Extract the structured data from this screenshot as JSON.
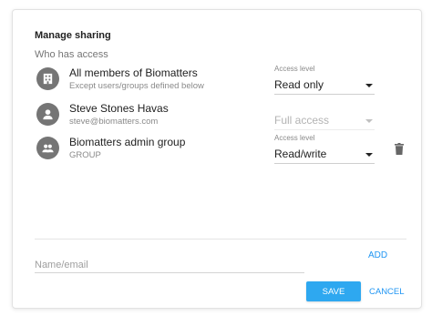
{
  "dialog": {
    "title": "Manage sharing",
    "subtitle": "Who has access"
  },
  "entries": [
    {
      "name": "All members of Biomatters",
      "sub": "Except users/groups defined below",
      "icon": "building-icon",
      "access_label": "Access level",
      "access_value": "Read only",
      "disabled": false
    },
    {
      "name": "Steve Stones Havas",
      "sub": "steve@biomatters.com",
      "icon": "person-icon",
      "access_label": "",
      "access_value": "Full access",
      "disabled": true
    },
    {
      "name": "Biomatters admin group",
      "sub": "GROUP",
      "icon": "group-icon",
      "access_label": "Access level",
      "access_value": "Read/write",
      "disabled": false
    }
  ],
  "add": {
    "placeholder": "Name/email",
    "add_label": "ADD"
  },
  "actions": {
    "save_label": "SAVE",
    "cancel_label": "CANCEL"
  },
  "colors": {
    "accent": "#2196f3",
    "save_bg": "#2ea8f0",
    "avatar": "#757575"
  }
}
